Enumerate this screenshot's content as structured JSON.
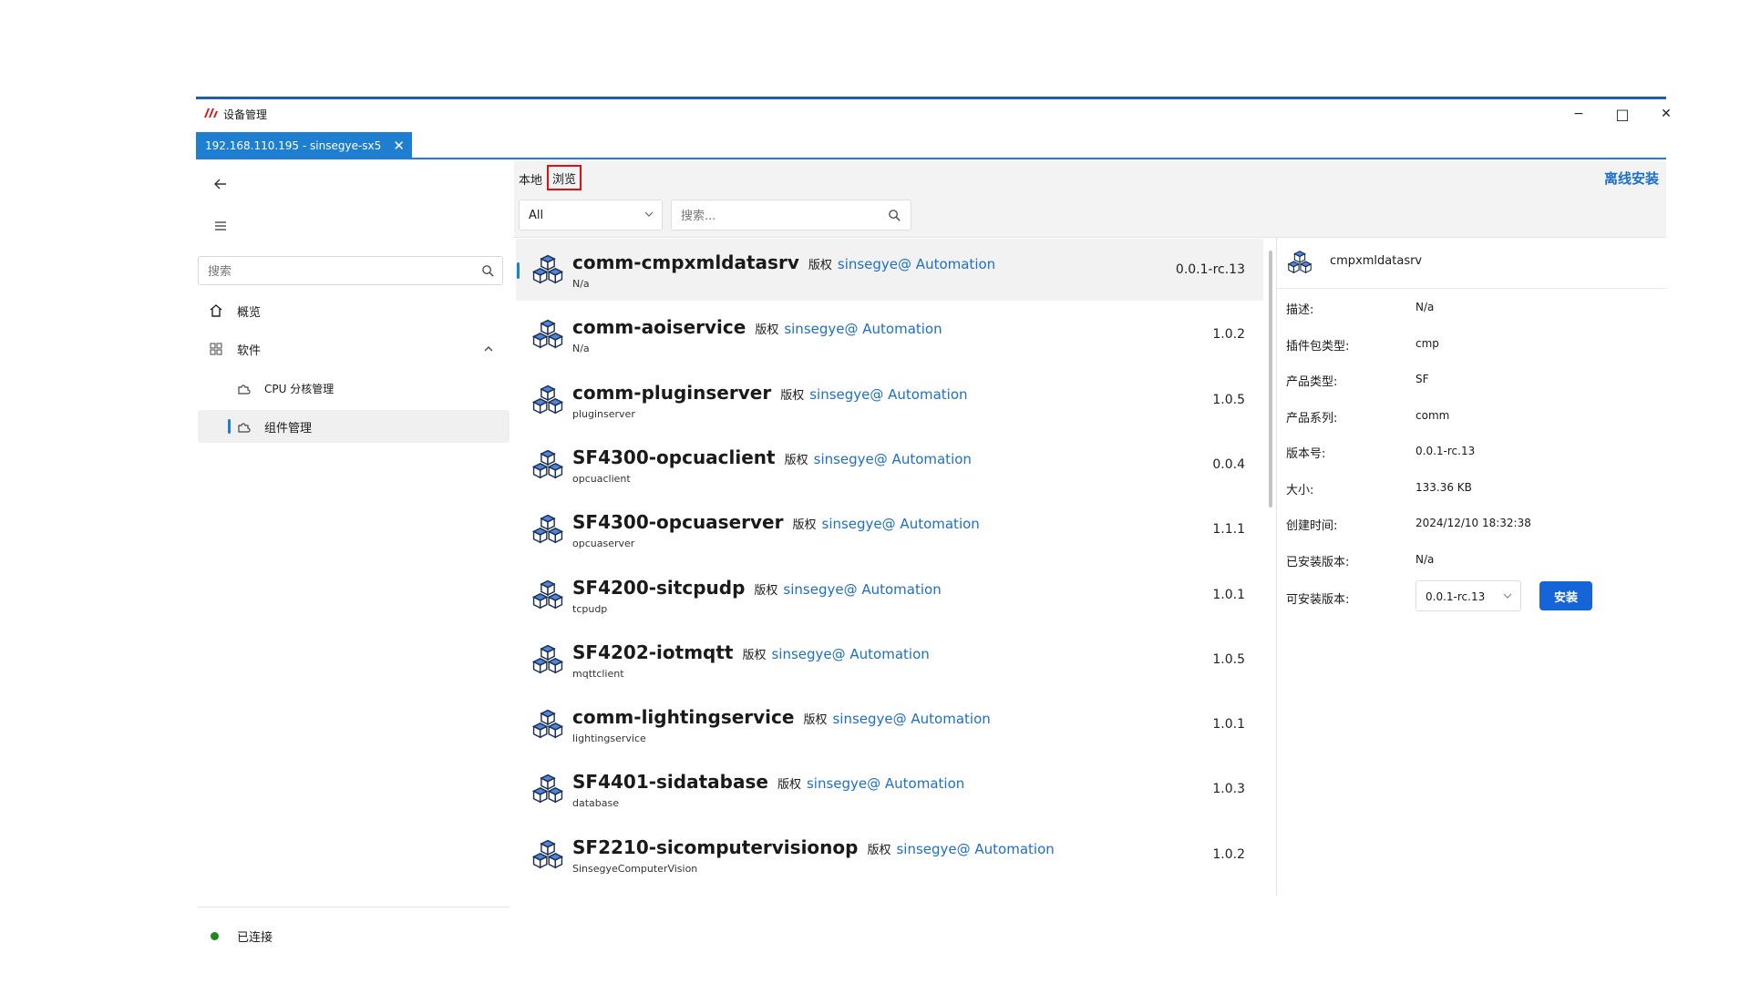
{
  "window": {
    "title": "设备管理",
    "brand_color": "#e01010",
    "accent_color": "#1e7fd0"
  },
  "window_controls": {
    "minimize": "−",
    "maximize": "□",
    "close": "✕"
  },
  "connection_tab": {
    "label": "192.168.110.195 - sinsegye-sx5",
    "close": "✕"
  },
  "sidebar": {
    "search_placeholder": "搜索",
    "items": [
      {
        "label": "概览",
        "icon": "home-icon"
      },
      {
        "label": "软件",
        "icon": "apps-grid-icon",
        "expanded": true
      },
      {
        "label": "CPU 分核管理",
        "icon": "plugin-icon"
      },
      {
        "label": "组件管理",
        "icon": "plugin-icon",
        "active": true
      }
    ],
    "status": {
      "text": "已连接",
      "color": "#1a8a1a"
    }
  },
  "main": {
    "tabs": [
      "本地",
      "浏览"
    ],
    "active_tab": "浏览",
    "offline_install": "离线安装",
    "category_select": {
      "value": "All"
    },
    "search_placeholder": "搜索..."
  },
  "packages": [
    {
      "name": "comm-cmpxmldatasrv",
      "copyright": "版权",
      "publisher": "sinsegye@ Automation",
      "desc": "N/a",
      "version": "0.0.1-rc.13",
      "selected": true
    },
    {
      "name": "comm-aoiservice",
      "copyright": "版权",
      "publisher": "sinsegye@ Automation",
      "desc": "N/a",
      "version": "1.0.2"
    },
    {
      "name": "comm-pluginserver",
      "copyright": "版权",
      "publisher": "sinsegye@ Automation",
      "desc": "pluginserver",
      "version": "1.0.5"
    },
    {
      "name": "SF4300-opcuaclient",
      "copyright": "版权",
      "publisher": "sinsegye@ Automation",
      "desc": "opcuaclient",
      "version": "0.0.4"
    },
    {
      "name": "SF4300-opcuaserver",
      "copyright": "版权",
      "publisher": "sinsegye@ Automation",
      "desc": "opcuaserver",
      "version": "1.1.1"
    },
    {
      "name": "SF4200-sitcpudp",
      "copyright": "版权",
      "publisher": "sinsegye@ Automation",
      "desc": "tcpudp",
      "version": "1.0.1"
    },
    {
      "name": "SF4202-iotmqtt",
      "copyright": "版权",
      "publisher": "sinsegye@ Automation",
      "desc": "mqttclient",
      "version": "1.0.5"
    },
    {
      "name": "comm-lightingservice",
      "copyright": "版权",
      "publisher": "sinsegye@ Automation",
      "desc": "lightingservice",
      "version": "1.0.1"
    },
    {
      "name": "SF4401-sidatabase",
      "copyright": "版权",
      "publisher": "sinsegye@ Automation",
      "desc": "database",
      "version": "1.0.3"
    },
    {
      "name": "SF2210-sicomputervisionop",
      "copyright": "版权",
      "publisher": "sinsegye@ Automation",
      "desc": "SinsegyeComputerVision",
      "version": "1.0.2"
    }
  ],
  "detail": {
    "title": "cmpxmldatasrv",
    "fields": [
      {
        "label": "描述:",
        "value": "N/a"
      },
      {
        "label": "插件包类型:",
        "value": "cmp"
      },
      {
        "label": "产品类型:",
        "value": "SF"
      },
      {
        "label": "产品系列:",
        "value": "comm"
      },
      {
        "label": "版本号:",
        "value": "0.0.1-rc.13"
      },
      {
        "label": "大小:",
        "value": "133.36 KB"
      },
      {
        "label": "创建时间:",
        "value": "2024/12/10 18:32:38"
      },
      {
        "label": "已安装版本:",
        "value": "N/a"
      }
    ],
    "installable_label": "可安装版本:",
    "installable_value": "0.0.1-rc.13",
    "install_button": "安装",
    "install_color": "#1565d8"
  }
}
